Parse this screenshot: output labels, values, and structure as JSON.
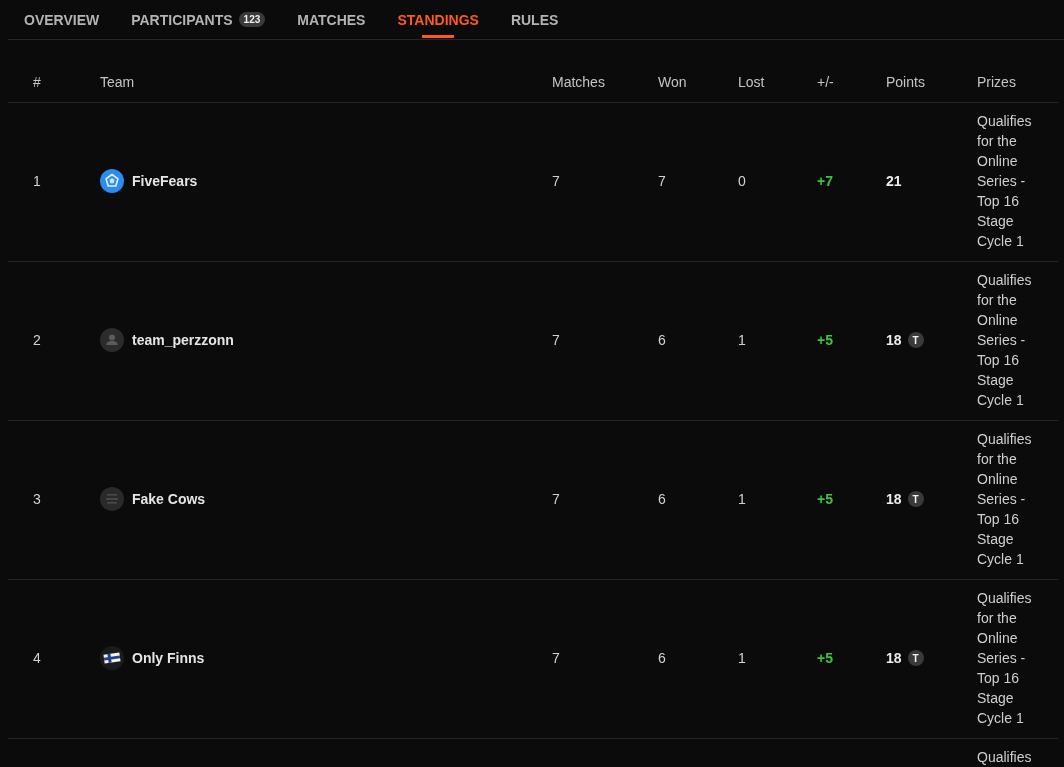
{
  "tabs": [
    {
      "label": "OVERVIEW",
      "selected": false
    },
    {
      "label": "PARTICIPANTS",
      "count": "123",
      "selected": false
    },
    {
      "label": "MATCHES",
      "selected": false
    },
    {
      "label": "STANDINGS",
      "selected": true
    },
    {
      "label": "RULES",
      "selected": false
    }
  ],
  "standings": {
    "columns": [
      "#",
      "Team",
      "Matches",
      "Won",
      "Lost",
      "+/-",
      "Points",
      "Prizes"
    ],
    "rows": [
      {
        "rank": "1",
        "team": "FiveFears",
        "logo": {
          "kind": "emblem"
        },
        "matches": "7",
        "won": "7",
        "lost": "0",
        "difference": "+7",
        "points": "21",
        "prizes": "Qualifies for the Online Series - Top 16 Stage Cycle 1"
      },
      {
        "rank": "2",
        "team": "team_perzzonn",
        "logo": {
          "kind": "avatar"
        },
        "matches": "7",
        "won": "6",
        "lost": "1",
        "difference": "+5",
        "points": "18",
        "tiebreak": "T",
        "prizes": "Qualifies for the Online Series - Top 16 Stage Cycle 1"
      },
      {
        "rank": "3",
        "team": "Fake Cows",
        "logo": {
          "kind": "crest"
        },
        "matches": "7",
        "won": "6",
        "lost": "1",
        "difference": "+5",
        "points": "18",
        "tiebreak": "T",
        "prizes": "Qualifies for the Online Series - Top 16 Stage Cycle 1"
      },
      {
        "rank": "4",
        "team": "Only Finns",
        "logo": {
          "kind": "flag"
        },
        "matches": "7",
        "won": "6",
        "lost": "1",
        "difference": "+5",
        "points": "18",
        "tiebreak": "T",
        "prizes": "Qualifies for the Online Series - Top 16 Stage Cycle 1"
      },
      {
        "prizes": "Qualifies"
      }
    ]
  }
}
